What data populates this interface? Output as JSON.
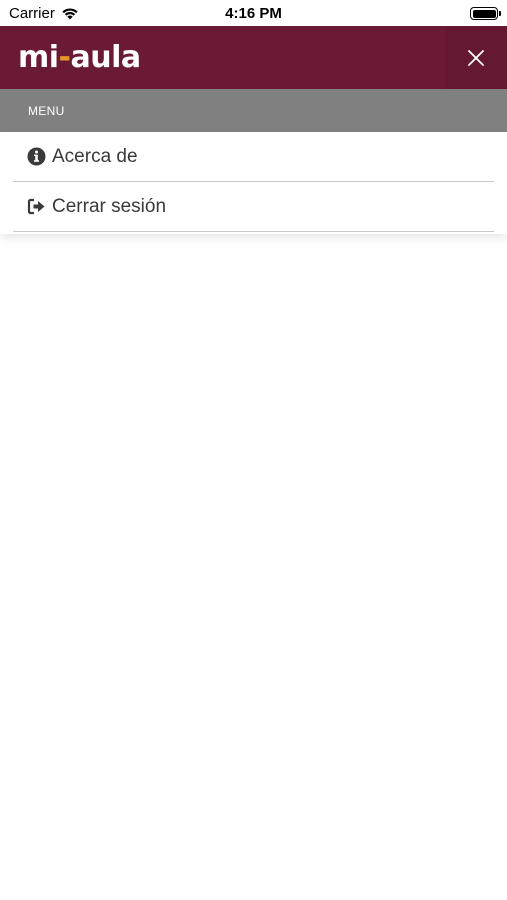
{
  "status_bar": {
    "carrier": "Carrier",
    "time": "4:16 PM"
  },
  "header": {
    "logo_left": "mi",
    "logo_dash": "-",
    "logo_right": "aula",
    "brand_color": "#6b1a35",
    "accent_color": "#e8962a"
  },
  "menu": {
    "title": "MENU",
    "items": [
      {
        "label": "Acerca de",
        "icon": "info-circle-icon"
      },
      {
        "label": "Cerrar sesión",
        "icon": "sign-out-icon"
      }
    ]
  }
}
